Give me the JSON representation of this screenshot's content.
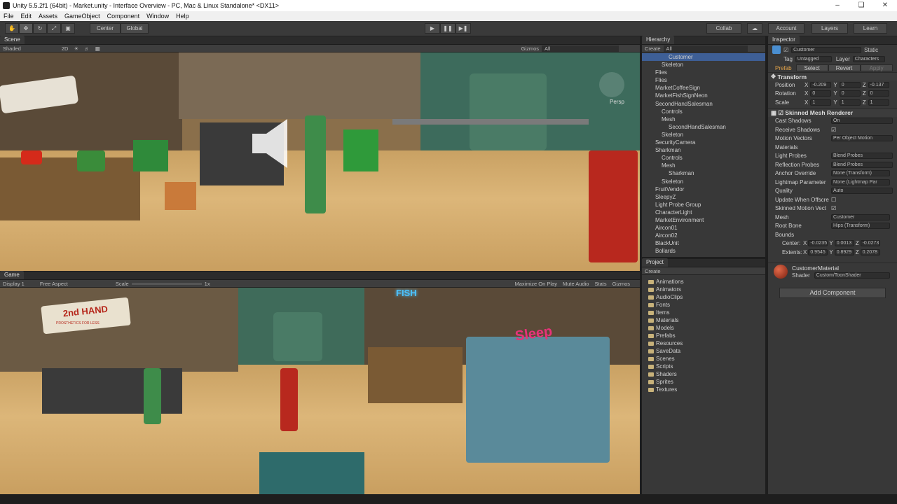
{
  "window": {
    "title": "Unity 5.5.2f1 (64bit) - Market.unity - Interface Overview - PC, Mac & Linux Standalone* <DX11>"
  },
  "menu": [
    "File",
    "Edit",
    "Assets",
    "GameObject",
    "Component",
    "Window",
    "Help"
  ],
  "toolbar": {
    "pivot": "Center",
    "space": "Global",
    "collab": "Collab",
    "account": "Account",
    "layers": "Layers",
    "layout": "Learn"
  },
  "scene": {
    "tab": "Scene",
    "shading": "Shaded",
    "mode2d": "2D",
    "gizmos": "Gizmos",
    "search": "All",
    "persp": "Persp"
  },
  "game": {
    "tab": "Game",
    "display": "Display 1",
    "aspect": "Free Aspect",
    "scale_label": "Scale",
    "scale_value": "1x",
    "maximize": "Maximize On Play",
    "mute": "Mute Audio",
    "stats": "Stats",
    "gizmos": "Gizmos"
  },
  "hierarchy": {
    "tab": "Hierarchy",
    "create": "Create",
    "search": "All",
    "items": [
      "Customer",
      "Skeleton",
      "Flies",
      "Flies",
      "MarketCoffeeSign",
      "MarketFishSignNeon",
      "SecondHandSalesman",
      "Controls",
      "Mesh",
      "SecondHandSalesman",
      "Skeleton",
      "SecurityCamera",
      "Sharkman",
      "Controls",
      "Mesh",
      "Sharkman",
      "Skeleton",
      "FruitVendor",
      "SleepyZ",
      "Light Probe Group",
      "CharacterLight",
      "MarketEnvironment",
      "Aircon01",
      "Aircon02",
      "BlackUnit",
      "Bollards"
    ]
  },
  "project": {
    "tab": "Project",
    "create": "Create",
    "folders": [
      "Animations",
      "Animators",
      "AudioClips",
      "Fonts",
      "Items",
      "Materials",
      "Models",
      "Prefabs",
      "Resources",
      "SaveData",
      "Scenes",
      "Scripts",
      "Shaders",
      "Sprites",
      "Textures"
    ]
  },
  "inspector": {
    "tab": "Inspector",
    "name": "Customer",
    "static": "Static",
    "tag_label": "Tag",
    "tag": "Untagged",
    "layer_label": "Layer",
    "layer": "Characters",
    "prefab": "Prefab",
    "select": "Select",
    "revert": "Revert",
    "apply": "Apply",
    "transform": {
      "title": "Transform",
      "position": {
        "label": "Position",
        "x": "-0.209",
        "y": "0",
        "z": "-0.137"
      },
      "rotation": {
        "label": "Rotation",
        "x": "0",
        "y": "0",
        "z": "0"
      },
      "scale": {
        "label": "Scale",
        "x": "1",
        "y": "1",
        "z": "1"
      }
    },
    "smr": {
      "title": "Skinned Mesh Renderer",
      "cast_shadows": "Cast Shadows",
      "cast_val": "On",
      "receive": "Receive Shadows",
      "motion": "Motion Vectors",
      "motion_val": "Per Object Motion",
      "materials": "Materials",
      "light_probes": "Light Probes",
      "lp_val": "Blend Probes",
      "refl": "Reflection Probes",
      "refl_val": "Blend Probes",
      "anchor": "Anchor Override",
      "anchor_val": "None (Transform)",
      "lmp": "Lightmap Parameter",
      "lmp_val": "None (Lightmap Par",
      "quality": "Quality",
      "quality_val": "Auto",
      "offscreen": "Update When Offscre",
      "skinned_motion": "Skinned Motion Vect",
      "mesh": "Mesh",
      "mesh_val": "Customer",
      "root": "Root Bone",
      "root_val": "Hips (Transform)",
      "bounds": "Bounds",
      "center": "Center:",
      "center_x": "-0.0235",
      "center_y": "0.0013",
      "center_z": "-0.0273",
      "extents": "Extents:",
      "extents_x": "0.9545",
      "extents_y": "0.8929",
      "extents_z": "0.2078"
    },
    "material": {
      "name": "CustomerMaterial",
      "shader_label": "Shader",
      "shader": "Custom/ToonShader"
    },
    "add_component": "Add Component"
  },
  "signs": {
    "second_hand": "2nd HAND",
    "prosthetics": "PROSTHETICS FOR LESS",
    "fish": "FISH",
    "sleep": "Sleep"
  }
}
